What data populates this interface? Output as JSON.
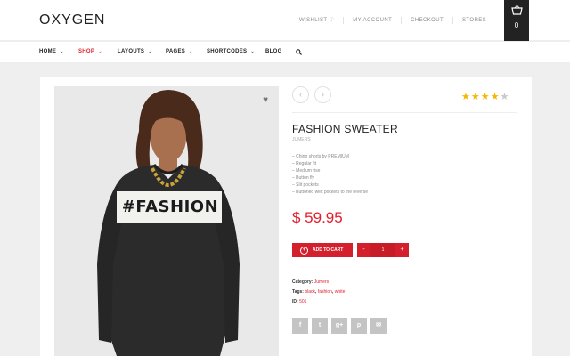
{
  "header": {
    "logo": "OXYGEN",
    "links": [
      "WISHLIST",
      "MY ACCOUNT",
      "CHECKOUT",
      "STORES"
    ],
    "cart_count": "0"
  },
  "nav": {
    "items": [
      {
        "label": "HOME",
        "chevron": "⌄"
      },
      {
        "label": "SHOP",
        "chevron": "⌄"
      },
      {
        "label": "LAYOUTS",
        "chevron": "⌄"
      },
      {
        "label": "PAGES",
        "chevron": "⌄"
      },
      {
        "label": "SHORTCODES",
        "chevron": "⌄"
      },
      {
        "label": "BLOG",
        "chevron": ""
      }
    ],
    "active_color": "#e0202e"
  },
  "product": {
    "shirt_text": "#FASHION",
    "rating": 4.5,
    "title": "FASHION SWEATER",
    "subtitle": "JUMERS",
    "features": [
      "– Chino shorts by PREMIUM",
      "– Regular fit",
      "– Medium rise",
      "– Button fly",
      "– Slit pockets",
      "– Buttoned welt pockets to the reverse"
    ],
    "price": "$ 59.95",
    "add_to_cart": "ADD TO CART",
    "quantity": "1",
    "qty_minus": "-",
    "qty_plus": "+",
    "category_label": "Category:",
    "category_value": "Jumers",
    "tags_label": "Tags:",
    "tags": [
      "black",
      "fashion",
      "white"
    ],
    "id_label": "ID:",
    "id_value": "501"
  },
  "share": [
    "f",
    "t",
    "g+",
    "p",
    "✉"
  ],
  "colors": {
    "accent": "#d41f2c",
    "price": "#e0202e",
    "star": "#f5b800"
  }
}
